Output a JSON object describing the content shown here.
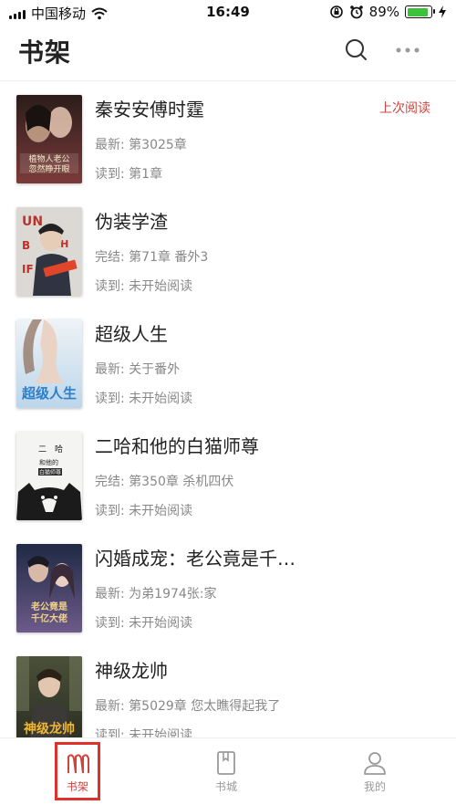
{
  "status_bar": {
    "carrier": "中国移动",
    "time": "16:49",
    "battery_percent": "89%",
    "battery_level": 0.89,
    "battery_color": "#3cc13b"
  },
  "header": {
    "title": "书架",
    "search_icon": "search-icon",
    "more_icon": "more-dots-icon"
  },
  "accent_color": "#d0443e",
  "books": [
    {
      "title": "秦安安傅时霆",
      "latest": "最新: 第3025章",
      "read": "读到: 第1章",
      "tag": "上次阅读",
      "cover_text": "植物人老公忽然睁开眼",
      "cover_colors": [
        "#2b1d1a",
        "#7a3b3a"
      ]
    },
    {
      "title": "伪装学渣",
      "latest": "完结: 第71章 番外3",
      "read": "读到: 未开始阅读",
      "tag": "",
      "cover_text": "UN BEACH IF",
      "cover_colors": [
        "#d9d6d2",
        "#3b3f4a"
      ]
    },
    {
      "title": "超级人生",
      "latest": "最新: 关于番外",
      "read": "读到: 未开始阅读",
      "tag": "",
      "cover_text": "超级人生",
      "cover_colors": [
        "#dfeaf3",
        "#9fc6e4"
      ]
    },
    {
      "title": "二哈和他的白猫师尊",
      "latest": "完结: 第350章 杀机四伏",
      "read": "读到: 未开始阅读",
      "tag": "",
      "cover_text": "二哈和他的白猫师尊",
      "cover_colors": [
        "#f4f4f2",
        "#1b1b1b"
      ]
    },
    {
      "title": "闪婚成宠：老公竟是千…",
      "latest": "最新: 为弟1974张:家",
      "read": "读到: 未开始阅读",
      "tag": "",
      "cover_text": "老公竟是千亿大佬",
      "cover_colors": [
        "#1f2a44",
        "#6d5a8a"
      ]
    },
    {
      "title": "神级龙帅",
      "latest": "最新: 第5029章 您太瞧得起我了",
      "read": "读到: 未开始阅读",
      "tag": "",
      "cover_text": "神级龙帅",
      "cover_colors": [
        "#3a3f2e",
        "#c79a2a"
      ]
    }
  ],
  "tab_bar": {
    "tabs": [
      {
        "label": "书架",
        "icon": "bookshelf-icon",
        "active": true
      },
      {
        "label": "书城",
        "icon": "bookstore-icon",
        "active": false
      },
      {
        "label": "我的",
        "icon": "profile-icon",
        "active": false
      }
    ]
  }
}
